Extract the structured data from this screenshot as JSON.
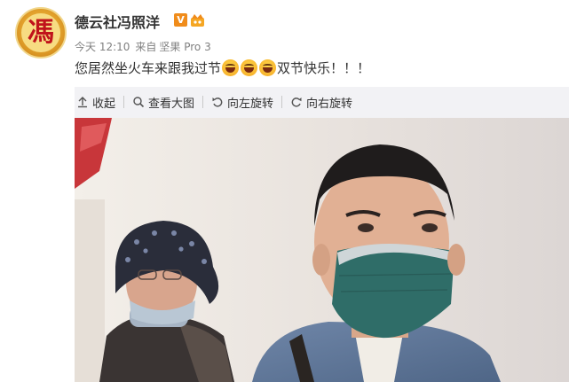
{
  "post": {
    "avatar_char": "馮",
    "username": "德云社冯照洋",
    "verified_badge": "V",
    "meta": {
      "time": "今天 12:10",
      "source_prefix": "来自",
      "device": "坚果 Pro 3"
    },
    "content_before": "您居然坐火车来跟我过节",
    "emoji_count": 3,
    "content_after": "双节快乐！！！"
  },
  "toolbar": {
    "collapse": "收起",
    "view_large": "查看大图",
    "rotate_left": "向左旋转",
    "rotate_right": "向右旋转"
  },
  "colors": {
    "accent_orange": "#f08c1b",
    "panel_bg": "#f2f2f5",
    "mask": "#2f6d68"
  }
}
